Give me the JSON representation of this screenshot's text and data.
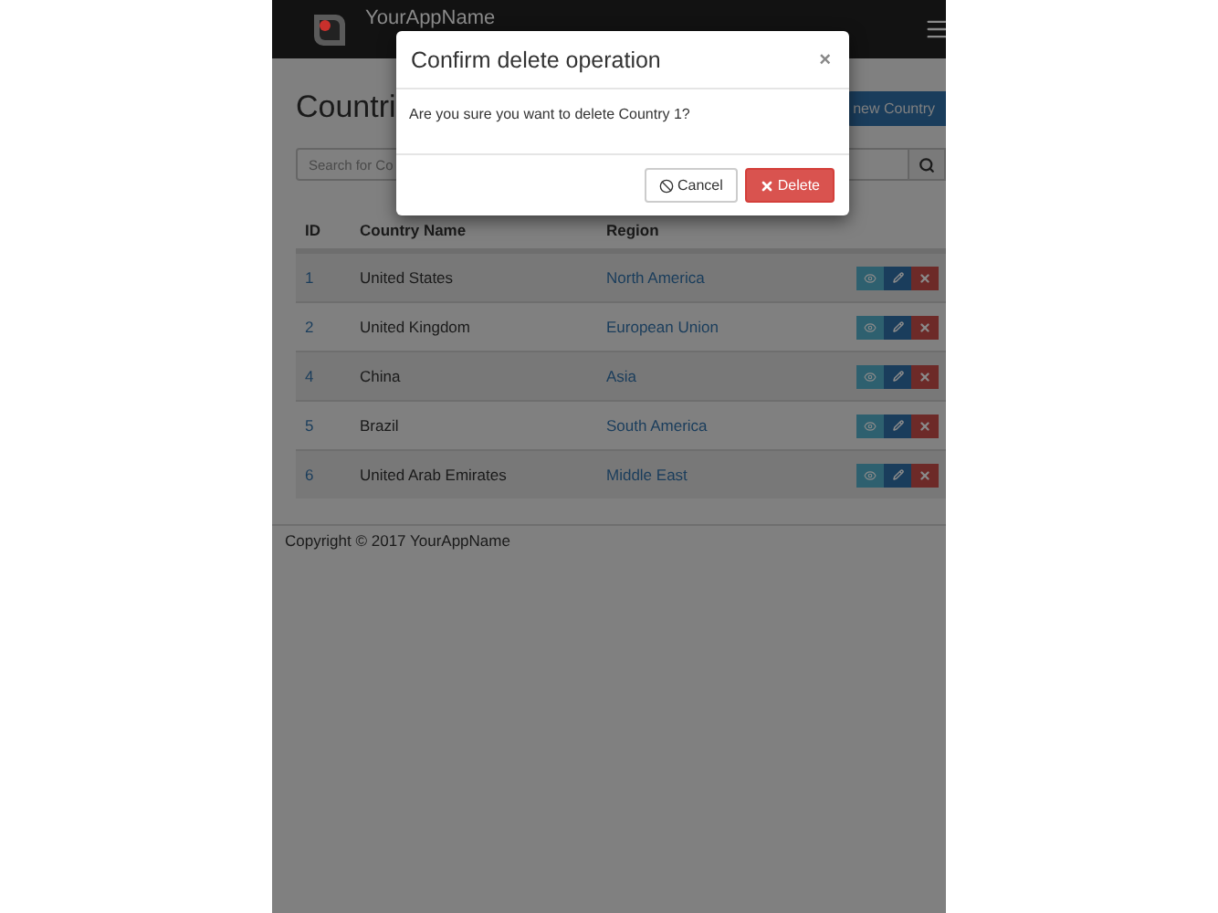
{
  "navbar": {
    "brand": "YourAppName"
  },
  "page": {
    "title": "Countri",
    "add_button": "new Country",
    "search": {
      "placeholder": "Search for Co"
    }
  },
  "table": {
    "columns": [
      "ID",
      "Country Name",
      "Region"
    ],
    "rows": [
      {
        "id": "1",
        "name": "United States",
        "region": "North America"
      },
      {
        "id": "2",
        "name": "United Kingdom",
        "region": "European Union"
      },
      {
        "id": "4",
        "name": "China",
        "region": "Asia"
      },
      {
        "id": "5",
        "name": "Brazil",
        "region": "South America"
      },
      {
        "id": "6",
        "name": "United Arab Emirates",
        "region": "Middle East"
      }
    ]
  },
  "footer": {
    "text": "Copyright © 2017 YourAppName"
  },
  "modal": {
    "title": "Confirm delete operation",
    "close": "×",
    "message": "Are you sure you want to delete Country 1?",
    "buttons": [
      {
        "label": "Cancel",
        "kind": "cancel"
      },
      {
        "label": "Delete",
        "kind": "delete"
      }
    ]
  }
}
